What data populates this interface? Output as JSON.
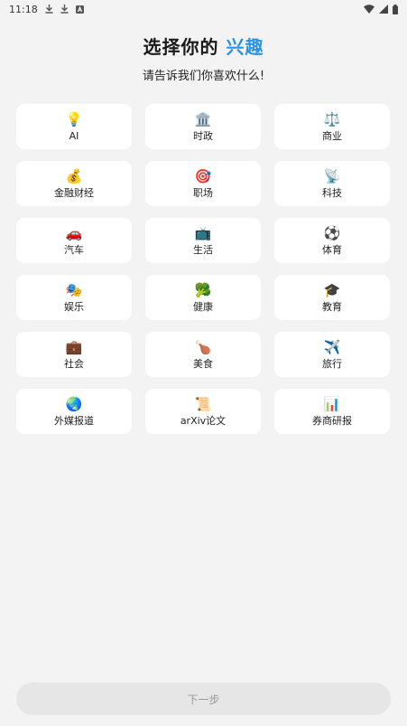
{
  "status_bar": {
    "time": "11:18"
  },
  "header": {
    "title_prefix": "选择你的",
    "title_accent": "兴趣",
    "subtitle": "请告诉我们你喜欢什么!"
  },
  "colors": {
    "accent": "#2b93e8",
    "background": "#f3f3f3",
    "card": "#ffffff",
    "button_disabled": "#e6e6e6"
  },
  "interests": [
    {
      "label": "AI",
      "emoji": "💡",
      "icon": "lightbulb-icon"
    },
    {
      "label": "时政",
      "emoji": "🏛️",
      "icon": "government-building-icon"
    },
    {
      "label": "商业",
      "emoji": "⚖️",
      "icon": "balance-scale-icon"
    },
    {
      "label": "金融财经",
      "emoji": "💰",
      "icon": "money-bag-icon"
    },
    {
      "label": "职场",
      "emoji": "🎯",
      "icon": "target-icon"
    },
    {
      "label": "科技",
      "emoji": "📡",
      "icon": "satellite-dish-icon"
    },
    {
      "label": "汽车",
      "emoji": "🚗",
      "icon": "car-icon"
    },
    {
      "label": "生活",
      "emoji": "📺",
      "icon": "television-icon"
    },
    {
      "label": "体育",
      "emoji": "⚽",
      "icon": "soccer-ball-icon"
    },
    {
      "label": "娱乐",
      "emoji": "🎭",
      "icon": "theater-masks-icon"
    },
    {
      "label": "健康",
      "emoji": "🥦",
      "icon": "broccoli-icon"
    },
    {
      "label": "教育",
      "emoji": "🎓",
      "icon": "graduation-cap-icon"
    },
    {
      "label": "社会",
      "emoji": "💼",
      "icon": "briefcase-icon"
    },
    {
      "label": "美食",
      "emoji": "🍗",
      "icon": "drumstick-icon"
    },
    {
      "label": "旅行",
      "emoji": "✈️",
      "icon": "airplane-icon"
    },
    {
      "label": "外媒报道",
      "emoji": "🌏",
      "icon": "globe-icon"
    },
    {
      "label": "arXiv论文",
      "emoji": "📜",
      "icon": "scroll-icon"
    },
    {
      "label": "券商研报",
      "emoji": "📊",
      "icon": "bar-chart-icon"
    }
  ],
  "footer": {
    "next_label": "下一步"
  }
}
